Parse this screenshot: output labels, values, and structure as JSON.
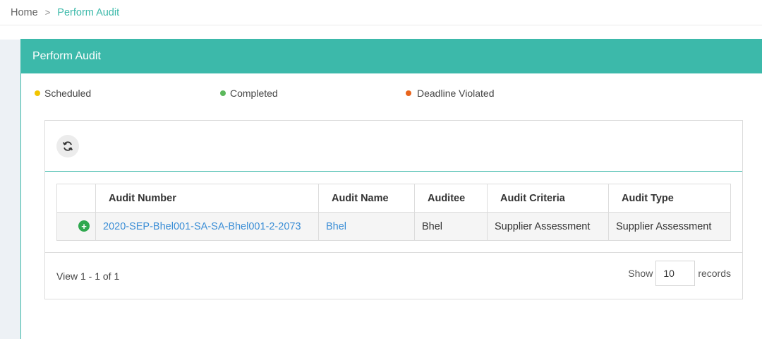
{
  "breadcrumb": {
    "home": "Home",
    "separator": ">",
    "current": "Perform Audit"
  },
  "panel": {
    "title": "Perform Audit"
  },
  "legend": [
    {
      "label": "Scheduled",
      "color": "#f2c500"
    },
    {
      "label": "Completed",
      "color": "#5cb85c"
    },
    {
      "label": "Deadline Violated",
      "color": "#e8641c"
    }
  ],
  "toolbar": {
    "refresh_icon": "refresh-icon"
  },
  "table": {
    "headers": [
      "",
      "Audit Number",
      "Audit Name",
      "Auditee",
      "Audit Criteria",
      "Audit Type"
    ],
    "rows": [
      {
        "expand_icon": "+",
        "audit_number": "2020-SEP-Bhel001-SA-SA-Bhel001-2-2073",
        "audit_name": "Bhel",
        "auditee": "Bhel",
        "audit_criteria": "Supplier Assessment",
        "audit_type": "Supplier Assessment"
      }
    ]
  },
  "pager": {
    "info": "View 1 - 1 of 1",
    "show_label": "Show",
    "page_size": "10",
    "records_label": "records"
  },
  "colors": {
    "accent": "#3cb9aa",
    "link": "#3b8ed6",
    "expand": "#2fa84f"
  }
}
